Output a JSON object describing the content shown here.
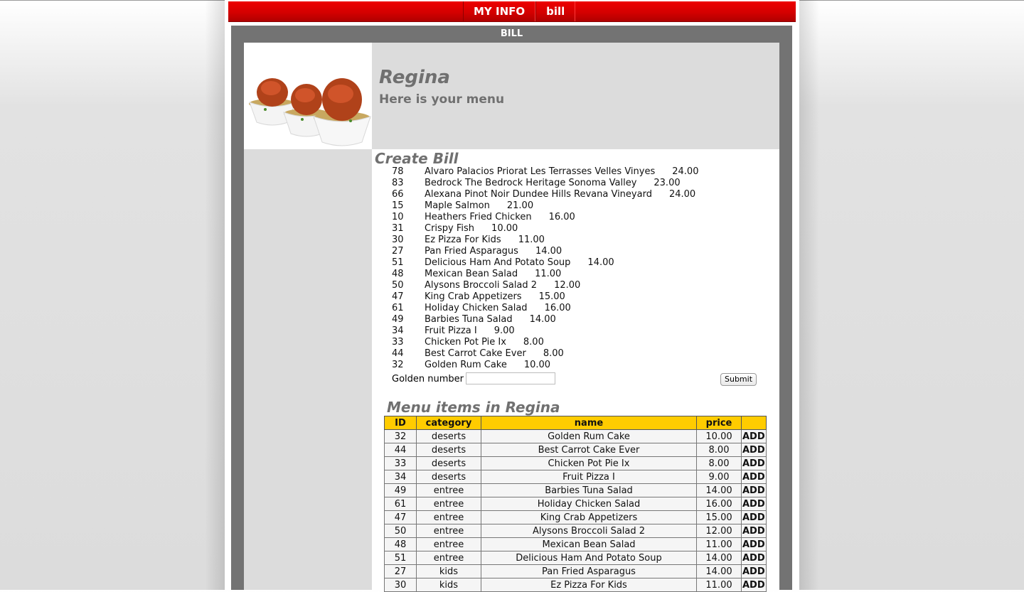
{
  "nav": {
    "items": [
      "MY INFO",
      "bill"
    ]
  },
  "frame": {
    "title": "BILL"
  },
  "header": {
    "restaurant": "Regina",
    "subtitle": "Here is your menu"
  },
  "create_bill": {
    "title": "Create Bill",
    "items": [
      {
        "id": "78",
        "name": "Alvaro Palacios Priorat Les Terrasses Velles Vinyes",
        "price": "24.00"
      },
      {
        "id": "83",
        "name": "Bedrock The Bedrock Heritage Sonoma Valley",
        "price": "23.00"
      },
      {
        "id": "66",
        "name": "Alexana Pinot Noir Dundee Hills Revana Vineyard",
        "price": "24.00"
      },
      {
        "id": "15",
        "name": "Maple Salmon",
        "price": "21.00"
      },
      {
        "id": "10",
        "name": "Heathers Fried Chicken",
        "price": "16.00"
      },
      {
        "id": "31",
        "name": "Crispy Fish",
        "price": "10.00"
      },
      {
        "id": "30",
        "name": "Ez Pizza For Kids",
        "price": "11.00"
      },
      {
        "id": "27",
        "name": "Pan Fried Asparagus",
        "price": "14.00"
      },
      {
        "id": "51",
        "name": "Delicious Ham And Potato Soup",
        "price": "14.00"
      },
      {
        "id": "48",
        "name": "Mexican Bean Salad",
        "price": "11.00"
      },
      {
        "id": "50",
        "name": "Alysons Broccoli Salad 2",
        "price": "12.00"
      },
      {
        "id": "47",
        "name": "King Crab Appetizers",
        "price": "15.00"
      },
      {
        "id": "61",
        "name": "Holiday Chicken Salad",
        "price": "16.00"
      },
      {
        "id": "49",
        "name": "Barbies Tuna Salad",
        "price": "14.00"
      },
      {
        "id": "34",
        "name": "Fruit Pizza I",
        "price": "9.00"
      },
      {
        "id": "33",
        "name": "Chicken Pot Pie Ix",
        "price": "8.00"
      },
      {
        "id": "44",
        "name": "Best Carrot Cake Ever",
        "price": "8.00"
      },
      {
        "id": "32",
        "name": "Golden Rum Cake",
        "price": "10.00"
      }
    ],
    "golden_label": "Golden number",
    "golden_value": "",
    "submit_label": "Submit"
  },
  "menu": {
    "title": "Menu items in Regina",
    "columns": [
      "ID",
      "category",
      "name",
      "price",
      ""
    ],
    "add_label": "ADD",
    "rows": [
      {
        "id": "32",
        "category": "deserts",
        "name": "Golden Rum Cake",
        "price": "10.00"
      },
      {
        "id": "44",
        "category": "deserts",
        "name": "Best Carrot Cake Ever",
        "price": "8.00"
      },
      {
        "id": "33",
        "category": "deserts",
        "name": "Chicken Pot Pie Ix",
        "price": "8.00"
      },
      {
        "id": "34",
        "category": "deserts",
        "name": "Fruit Pizza I",
        "price": "9.00"
      },
      {
        "id": "49",
        "category": "entree",
        "name": "Barbies Tuna Salad",
        "price": "14.00"
      },
      {
        "id": "61",
        "category": "entree",
        "name": "Holiday Chicken Salad",
        "price": "16.00"
      },
      {
        "id": "47",
        "category": "entree",
        "name": "King Crab Appetizers",
        "price": "15.00"
      },
      {
        "id": "50",
        "category": "entree",
        "name": "Alysons Broccoli Salad 2",
        "price": "12.00"
      },
      {
        "id": "48",
        "category": "entree",
        "name": "Mexican Bean Salad",
        "price": "11.00"
      },
      {
        "id": "51",
        "category": "entree",
        "name": "Delicious Ham And Potato Soup",
        "price": "14.00"
      },
      {
        "id": "27",
        "category": "kids",
        "name": "Pan Fried Asparagus",
        "price": "14.00"
      },
      {
        "id": "30",
        "category": "kids",
        "name": "Ez Pizza For Kids",
        "price": "11.00"
      }
    ]
  },
  "colors": {
    "nav_red": "#d40000",
    "frame_gray": "#737373",
    "header_gray": "#dcdcdc",
    "table_header": "#ffcc00",
    "heading_text": "#707070"
  }
}
